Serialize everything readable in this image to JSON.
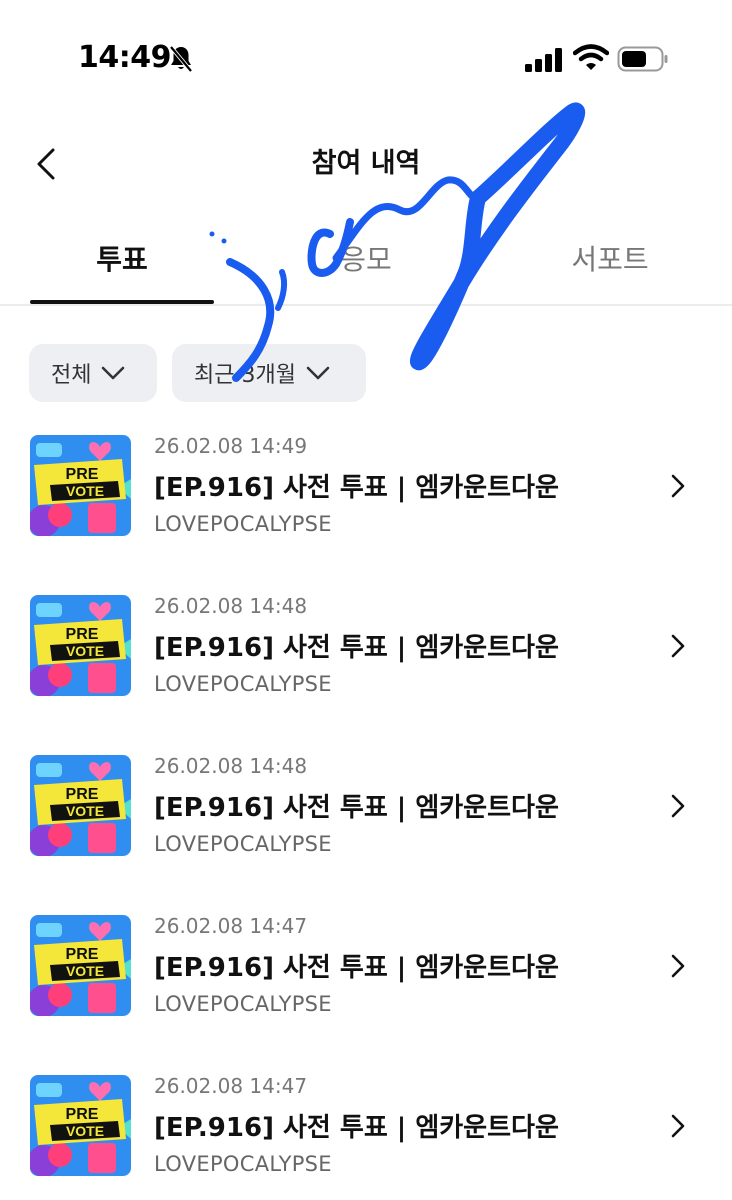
{
  "status_bar": {
    "time": "14:49",
    "icons": [
      "bell-slash-icon",
      "signal-icon",
      "wifi-icon",
      "battery-icon"
    ]
  },
  "header": {
    "back_icon": "chevron-left-icon",
    "title": "참여 내역"
  },
  "tabs": [
    {
      "label": "투표",
      "active": true
    },
    {
      "label": "응모",
      "active": false
    },
    {
      "label": "서포트",
      "active": false
    }
  ],
  "filters": [
    {
      "label": "전체",
      "icon": "chevron-down-icon"
    },
    {
      "label": "최근 3개월",
      "icon": "chevron-down-icon"
    }
  ],
  "items": [
    {
      "date": "26.02.08 14:49",
      "title": "[EP.916] 사전 투표 | 엠카운트다운",
      "artist": "LOVEPOCALYPSE",
      "thumb_text": [
        "PRE",
        "VOTE"
      ]
    },
    {
      "date": "26.02.08 14:48",
      "title": "[EP.916] 사전 투표 | 엠카운트다운",
      "artist": "LOVEPOCALYPSE",
      "thumb_text": [
        "PRE",
        "VOTE"
      ]
    },
    {
      "date": "26.02.08 14:48",
      "title": "[EP.916] 사전 투표 | 엠카운트다운",
      "artist": "LOVEPOCALYPSE",
      "thumb_text": [
        "PRE",
        "VOTE"
      ]
    },
    {
      "date": "26.02.08 14:47",
      "title": "[EP.916] 사전 투표 | 엠카운트다운",
      "artist": "LOVEPOCALYPSE",
      "thumb_text": [
        "PRE",
        "VOTE"
      ]
    },
    {
      "date": "26.02.08 14:47",
      "title": "[EP.916] 사전 투표 | 엠카운트다운",
      "artist": "LOVEPOCALYPSE",
      "thumb_text": [
        "PRE",
        "VOTE"
      ]
    }
  ],
  "colors": {
    "active_tab": "#111111",
    "inactive_tab": "#777777",
    "filter_bg": "#eeeff2",
    "scribble": "#1a5cf0",
    "thumb_bg": "#2f8ef0",
    "thumb_banner": "#f5e63a"
  }
}
